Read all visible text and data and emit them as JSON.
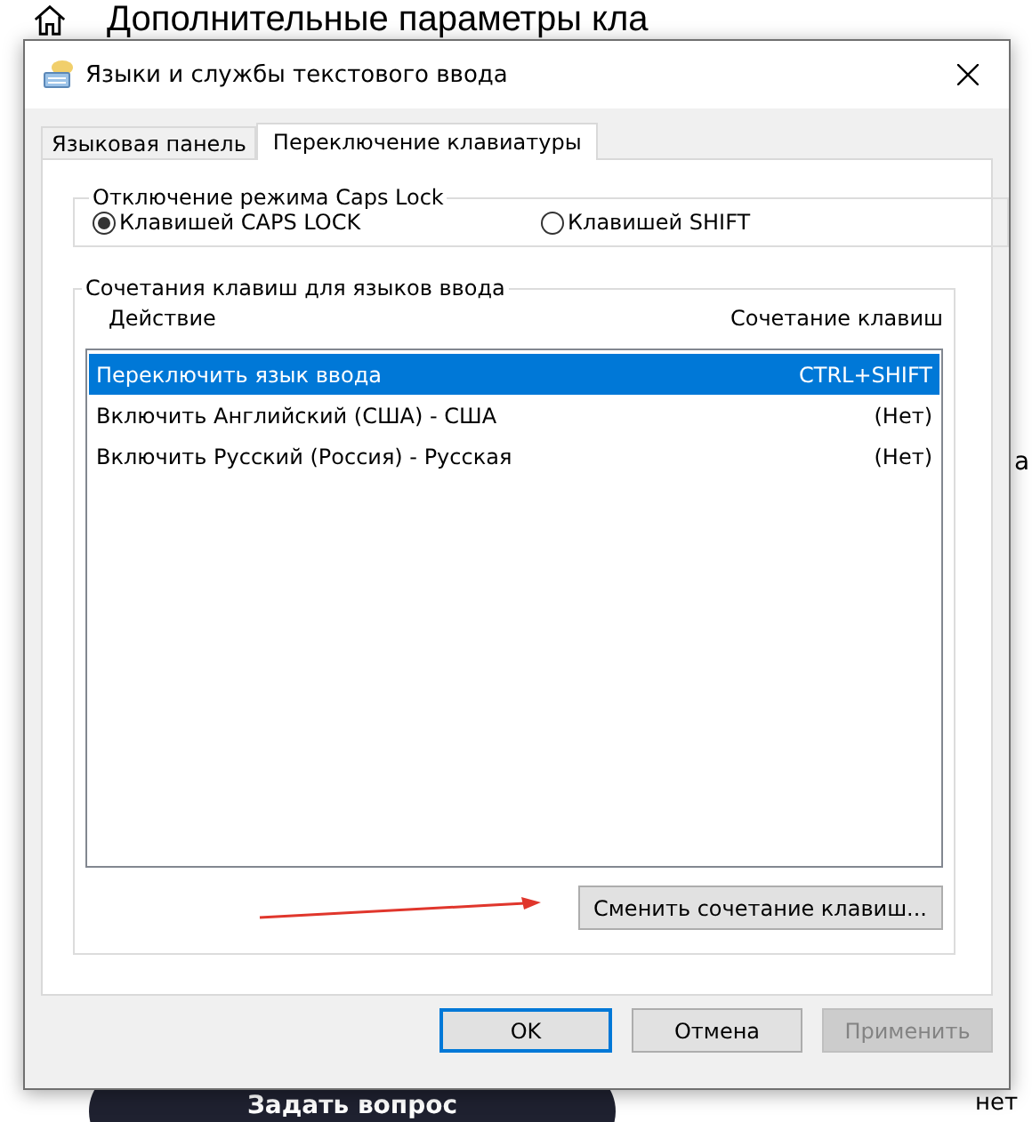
{
  "page": {
    "heading": "Дополнительные параметры кла",
    "side_text": "а",
    "side_text_2": "нет",
    "ask_button": "Задать вопрос"
  },
  "dialog": {
    "title": "Языки и службы текстового ввода",
    "tabs": [
      {
        "label": "Языковая панель",
        "selected": false
      },
      {
        "label": "Переключение клавиатуры",
        "selected": true
      }
    ],
    "caps_group": {
      "title": "Отключение режима Caps Lock",
      "options": [
        {
          "label": "Клавишей CAPS LOCK",
          "selected": true
        },
        {
          "label": "Клавишей SHIFT",
          "selected": false
        }
      ]
    },
    "hotkeys_group": {
      "title": "Сочетания клавиш для языков ввода",
      "columns": [
        "Действие",
        "Сочетание клавиш"
      ],
      "rows": [
        {
          "action": "Переключить язык ввода",
          "keys": "CTRL+SHIFT",
          "selected": true
        },
        {
          "action": "Включить Английский (США) - США",
          "keys": "(Нет)",
          "selected": false
        },
        {
          "action": "Включить Русский (Россия) - Русская",
          "keys": "(Нет)",
          "selected": false
        }
      ],
      "change_button": "Сменить сочетание клавиш..."
    },
    "buttons": [
      {
        "label": "OK",
        "kind": "default",
        "disabled": false
      },
      {
        "label": "Отмена",
        "kind": "normal",
        "disabled": false
      },
      {
        "label": "Применить",
        "kind": "normal",
        "disabled": true
      }
    ]
  }
}
